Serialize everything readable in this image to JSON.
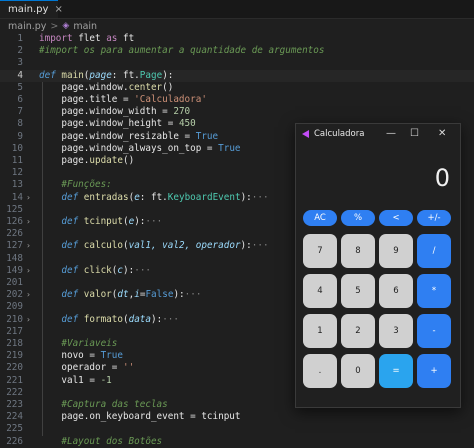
{
  "tab": {
    "filename": "main.py",
    "close": "×"
  },
  "breadcrumb": {
    "file": "main.py",
    "sep": ">",
    "symbol": "main"
  },
  "lines": [
    {
      "n": "1",
      "parts": [
        [
          "kw2",
          "import"
        ],
        [
          "var",
          " flet "
        ],
        [
          "kw2",
          "as"
        ],
        [
          "var",
          " ft"
        ]
      ]
    },
    {
      "n": "2",
      "parts": [
        [
          "cm",
          "#import os para aumentar a quantidade de argumentos"
        ]
      ]
    },
    {
      "n": "3",
      "parts": []
    },
    {
      "n": "4",
      "cur": true,
      "parts": [
        [
          "kw",
          "def"
        ],
        [
          "var",
          " "
        ],
        [
          "fn",
          "main"
        ],
        [
          "var",
          "("
        ],
        [
          "par",
          "page"
        ],
        [
          "var",
          ": ft."
        ],
        [
          "cls",
          "Page"
        ],
        [
          "var",
          "):"
        ]
      ]
    },
    {
      "n": "5",
      "parts": [
        [
          "var",
          "    page.window."
        ],
        [
          "fn",
          "center"
        ],
        [
          "var",
          "()"
        ]
      ]
    },
    {
      "n": "6",
      "parts": [
        [
          "var",
          "    page.title = "
        ],
        [
          "str",
          "'Calculadora'"
        ]
      ]
    },
    {
      "n": "7",
      "parts": [
        [
          "var",
          "    page.window_width = "
        ],
        [
          "num",
          "270"
        ]
      ]
    },
    {
      "n": "8",
      "parts": [
        [
          "var",
          "    page.window_height = "
        ],
        [
          "num",
          "450"
        ]
      ]
    },
    {
      "n": "9",
      "parts": [
        [
          "var",
          "    page.window_resizable = "
        ],
        [
          "bool",
          "True"
        ]
      ]
    },
    {
      "n": "10",
      "parts": [
        [
          "var",
          "    page.window_always_on_top = "
        ],
        [
          "bool",
          "True"
        ]
      ]
    },
    {
      "n": "11",
      "parts": [
        [
          "var",
          "    page."
        ],
        [
          "fn",
          "update"
        ],
        [
          "var",
          "()"
        ]
      ]
    },
    {
      "n": "12",
      "parts": []
    },
    {
      "n": "13",
      "parts": [
        [
          "cm",
          "    #Funções:"
        ]
      ]
    },
    {
      "n": "14",
      "fold": true,
      "parts": [
        [
          "kw",
          "    def"
        ],
        [
          "var",
          " "
        ],
        [
          "fn",
          "entradas"
        ],
        [
          "var",
          "("
        ],
        [
          "par",
          "e"
        ],
        [
          "var",
          ": ft."
        ],
        [
          "cls",
          "KeyboardEvent"
        ],
        [
          "var",
          "):"
        ],
        [
          "ell",
          "···"
        ]
      ]
    },
    {
      "n": "125",
      "parts": []
    },
    {
      "n": "126",
      "fold": true,
      "parts": [
        [
          "kw",
          "    def"
        ],
        [
          "var",
          " "
        ],
        [
          "fn",
          "tcinput"
        ],
        [
          "var",
          "("
        ],
        [
          "par",
          "e"
        ],
        [
          "var",
          "):"
        ],
        [
          "ell",
          "···"
        ]
      ]
    },
    {
      "n": "226",
      "parts": []
    },
    {
      "n": "127",
      "fold": true,
      "parts": [
        [
          "kw",
          "    def"
        ],
        [
          "var",
          " "
        ],
        [
          "fn",
          "calculo"
        ],
        [
          "var",
          "("
        ],
        [
          "par",
          "val1, val2, operador"
        ],
        [
          "var",
          "):"
        ],
        [
          "ell",
          "···"
        ]
      ]
    },
    {
      "n": "148",
      "parts": []
    },
    {
      "n": "149",
      "fold": true,
      "parts": [
        [
          "kw",
          "    def"
        ],
        [
          "var",
          " "
        ],
        [
          "fn",
          "click"
        ],
        [
          "var",
          "("
        ],
        [
          "par",
          "c"
        ],
        [
          "var",
          "):"
        ],
        [
          "ell",
          "···"
        ]
      ]
    },
    {
      "n": "201",
      "parts": []
    },
    {
      "n": "202",
      "fold": true,
      "parts": [
        [
          "kw",
          "    def"
        ],
        [
          "var",
          " "
        ],
        [
          "fn",
          "valor"
        ],
        [
          "var",
          "("
        ],
        [
          "par",
          "dt"
        ],
        [
          "var",
          ","
        ],
        [
          "par",
          "i"
        ],
        [
          "var",
          "="
        ],
        [
          "bool",
          "False"
        ],
        [
          "var",
          "):"
        ],
        [
          "ell",
          "···"
        ]
      ]
    },
    {
      "n": "209",
      "parts": []
    },
    {
      "n": "210",
      "fold": true,
      "parts": [
        [
          "kw",
          "    def"
        ],
        [
          "var",
          " "
        ],
        [
          "fn",
          "formato"
        ],
        [
          "var",
          "("
        ],
        [
          "par",
          "data"
        ],
        [
          "var",
          "):"
        ],
        [
          "ell",
          "···"
        ]
      ]
    },
    {
      "n": "217",
      "parts": []
    },
    {
      "n": "218",
      "parts": [
        [
          "cm",
          "    #Variaveis"
        ]
      ]
    },
    {
      "n": "219",
      "parts": [
        [
          "var",
          "    novo = "
        ],
        [
          "bool",
          "True"
        ]
      ]
    },
    {
      "n": "220",
      "parts": [
        [
          "var",
          "    operador = "
        ],
        [
          "str",
          "''"
        ]
      ]
    },
    {
      "n": "221",
      "parts": [
        [
          "var",
          "    val1 = "
        ],
        [
          "num",
          "-1"
        ]
      ]
    },
    {
      "n": "222",
      "parts": []
    },
    {
      "n": "223",
      "parts": [
        [
          "cm",
          "    #Captura das teclas"
        ]
      ]
    },
    {
      "n": "224",
      "parts": [
        [
          "var",
          "    page.on_keyboard_event = tcinput"
        ]
      ]
    },
    {
      "n": "225",
      "parts": []
    },
    {
      "n": "226",
      "parts": [
        [
          "cm",
          "    #Layout dos Botões"
        ]
      ]
    }
  ],
  "calculator": {
    "title": "Calculadora",
    "controls": {
      "minimize": "—",
      "maximize": "☐",
      "close": "✕"
    },
    "display": "0",
    "buttons": [
      {
        "label": "AC",
        "kind": "op pill",
        "col": 0,
        "row": 0
      },
      {
        "label": "%",
        "kind": "op pill",
        "col": 1,
        "row": 0
      },
      {
        "label": "<",
        "kind": "op pill",
        "col": 2,
        "row": 0
      },
      {
        "label": "+/-",
        "kind": "op pill",
        "col": 3,
        "row": 0
      },
      {
        "label": "7",
        "kind": "num",
        "col": 0,
        "row": 1
      },
      {
        "label": "8",
        "kind": "num",
        "col": 1,
        "row": 1
      },
      {
        "label": "9",
        "kind": "num",
        "col": 2,
        "row": 1
      },
      {
        "label": "/",
        "kind": "op",
        "col": 3,
        "row": 1
      },
      {
        "label": "4",
        "kind": "num",
        "col": 0,
        "row": 2
      },
      {
        "label": "5",
        "kind": "num",
        "col": 1,
        "row": 2
      },
      {
        "label": "6",
        "kind": "num",
        "col": 2,
        "row": 2
      },
      {
        "label": "*",
        "kind": "op",
        "col": 3,
        "row": 2
      },
      {
        "label": "1",
        "kind": "num",
        "col": 0,
        "row": 3
      },
      {
        "label": "2",
        "kind": "num",
        "col": 1,
        "row": 3
      },
      {
        "label": "3",
        "kind": "num",
        "col": 2,
        "row": 3
      },
      {
        "label": "-",
        "kind": "op",
        "col": 3,
        "row": 3
      },
      {
        "label": ".",
        "kind": "num",
        "col": 0,
        "row": 4
      },
      {
        "label": "0",
        "kind": "num",
        "col": 1,
        "row": 4
      },
      {
        "label": "=",
        "kind": "eq",
        "col": 2,
        "row": 4
      },
      {
        "label": "+",
        "kind": "op",
        "col": 3,
        "row": 4
      }
    ]
  },
  "colors": {
    "editor_bg": "#1f1f1f",
    "accent": "#2f7ff2",
    "equals": "#2aa4ee",
    "number_key": "#d0d0d0"
  }
}
